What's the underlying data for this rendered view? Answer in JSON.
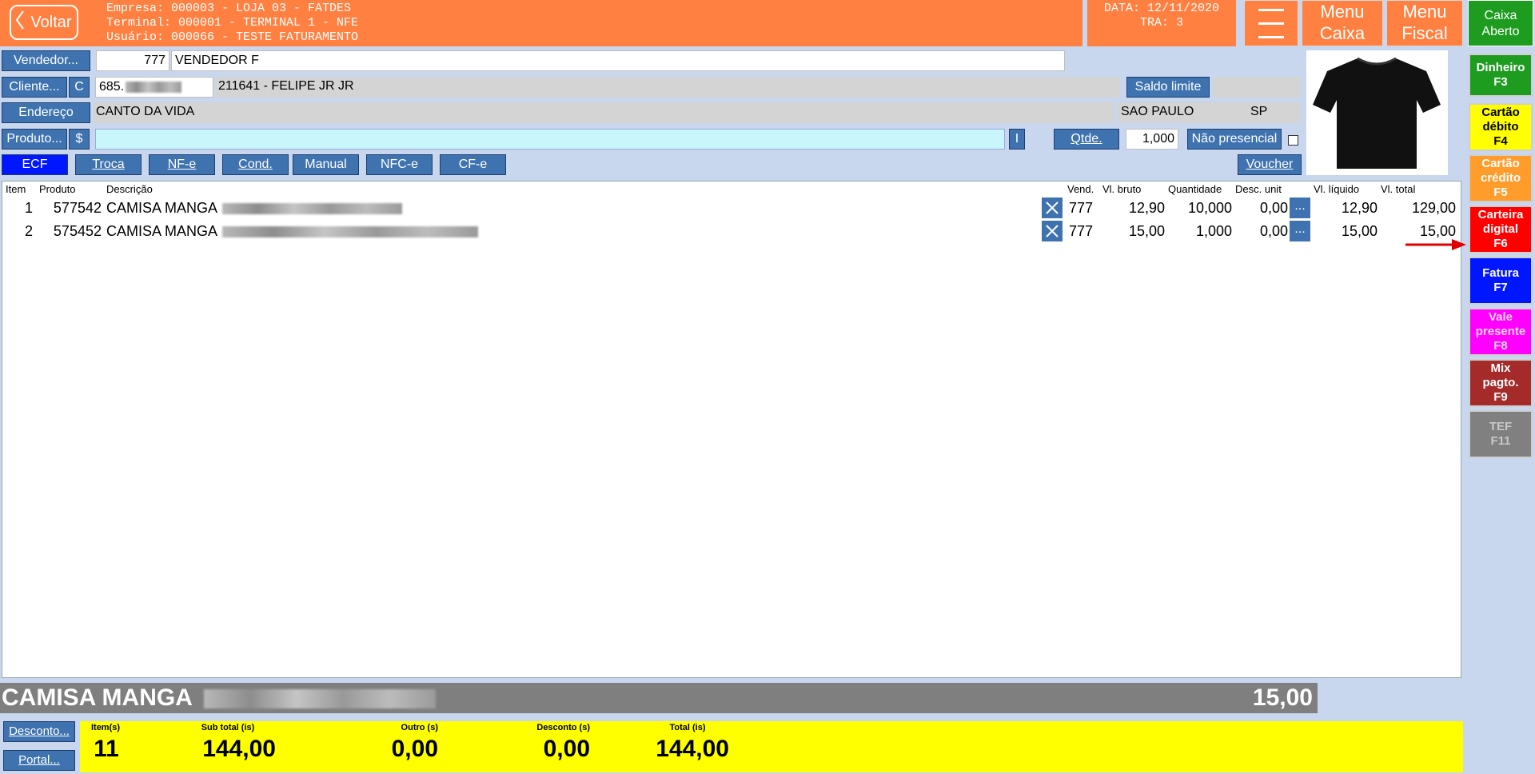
{
  "header": {
    "back_label": "Voltar",
    "empresa": "Empresa: 000003 - LOJA 03 - FATDES",
    "terminal": "Terminal: 000001 - TERMINAL 1 - NFE",
    "usuario": "Usuário: 000066 - TESTE FATURAMENTO",
    "data": "DATA: 12/11/2020",
    "tra": "TRA: 3",
    "menu_caixa": [
      "Menu",
      "Caixa"
    ],
    "menu_fiscal": [
      "Menu",
      "Fiscal"
    ],
    "caixa_status": [
      "Caixa",
      "Aberto"
    ]
  },
  "form": {
    "vendedor_btn": "Vendedor...",
    "vendedor_code": "777",
    "vendedor_name": "VENDEDOR F",
    "cliente_btn": "Cliente...",
    "cliente_c": "C",
    "cliente_cpf": "685.",
    "cliente_name": "211641 - FELIPE JR JR",
    "saldo_limite": "Saldo limite",
    "endereco_btn": "Endereço",
    "endereco": "CANTO DA VIDA",
    "cidade": "SAO PAULO",
    "uf": "SP",
    "produto_btn": "Produto...",
    "produto_dollar": "$",
    "produto_i": "I",
    "qtde_btn": "Qtde.",
    "qtde_value": "1,000",
    "nao_presencial": "Não presencial",
    "voucher": "Voucher"
  },
  "modes": [
    {
      "label": "ECF",
      "active": true
    },
    {
      "label": "Troca"
    },
    {
      "label": "NF-e"
    },
    {
      "label": "Cond."
    },
    {
      "label": "Manual"
    },
    {
      "label": "NFC-e"
    },
    {
      "label": "CF-e"
    }
  ],
  "table": {
    "columns": [
      "Item",
      "Produto",
      "Descrição",
      "Vend.",
      "Vl. bruto",
      "Quantidade",
      "Desc. unit",
      "Vl. líquido",
      "Vl. total"
    ],
    "rows": [
      {
        "item": "1",
        "produto": "577542",
        "descricao": "CAMISA MANGA",
        "vend": "777",
        "bruto": "12,90",
        "qtd": "10,000",
        "desc": "0,00",
        "liquido": "12,90",
        "total": "129,00"
      },
      {
        "item": "2",
        "produto": "575452",
        "descricao": "CAMISA MANGA",
        "vend": "777",
        "bruto": "15,00",
        "qtd": "1,000",
        "desc": "0,00",
        "liquido": "15,00",
        "total": "15,00"
      }
    ],
    "dots_label": "..."
  },
  "payments": [
    {
      "label": "Dinheiro F3",
      "lines": [
        "Dinheiro",
        "F3"
      ],
      "bg": "#1e9c20",
      "fg": "#ffffff"
    },
    {
      "label": "Cartão débito F4",
      "lines": [
        "Cartão",
        "débito",
        "F4"
      ],
      "bg": "#ffff00",
      "fg": "#000000"
    },
    {
      "label": "Cartão crédito F5",
      "lines": [
        "Cartão",
        "crédito",
        "F5"
      ],
      "bg": "#ff9c2a",
      "fg": "#ffffff"
    },
    {
      "label": "Carteira digital F6",
      "lines": [
        "Carteira",
        "digital",
        "F6"
      ],
      "bg": "#ff0000",
      "fg": "#ffffff"
    },
    {
      "label": "Fatura F7",
      "lines": [
        "Fatura",
        "F7"
      ],
      "bg": "#0016ff",
      "fg": "#ffffff"
    },
    {
      "label": "Vale presente F8",
      "lines": [
        "Vale",
        "presente",
        "F8"
      ],
      "bg": "#ff00ff",
      "fg": "#ffffff"
    },
    {
      "label": "Mix pagto. F9",
      "lines": [
        "Mix",
        "pagto.",
        "F9"
      ],
      "bg": "#a52a2a",
      "fg": "#ffffff"
    },
    {
      "label": "TEF F11",
      "lines": [
        "TEF",
        "F11"
      ],
      "bg": "#808080",
      "fg": "#c8c8c8"
    }
  ],
  "bottom": {
    "current_desc": "CAMISA MANGA",
    "current_value": "15,00",
    "desconto_btn": "Desconto...",
    "portal_btn": "Portal...",
    "totals": {
      "itens_label": "Item(s)",
      "itens": "11",
      "subtotal_label": "Sub total (is)",
      "subtotal": "144,00",
      "outro_label": "Outro (s)",
      "outro": "0,00",
      "desconto_label": "Desconto (s)",
      "desconto": "0,00",
      "total_label": "Total (is)",
      "total": "144,00"
    }
  }
}
